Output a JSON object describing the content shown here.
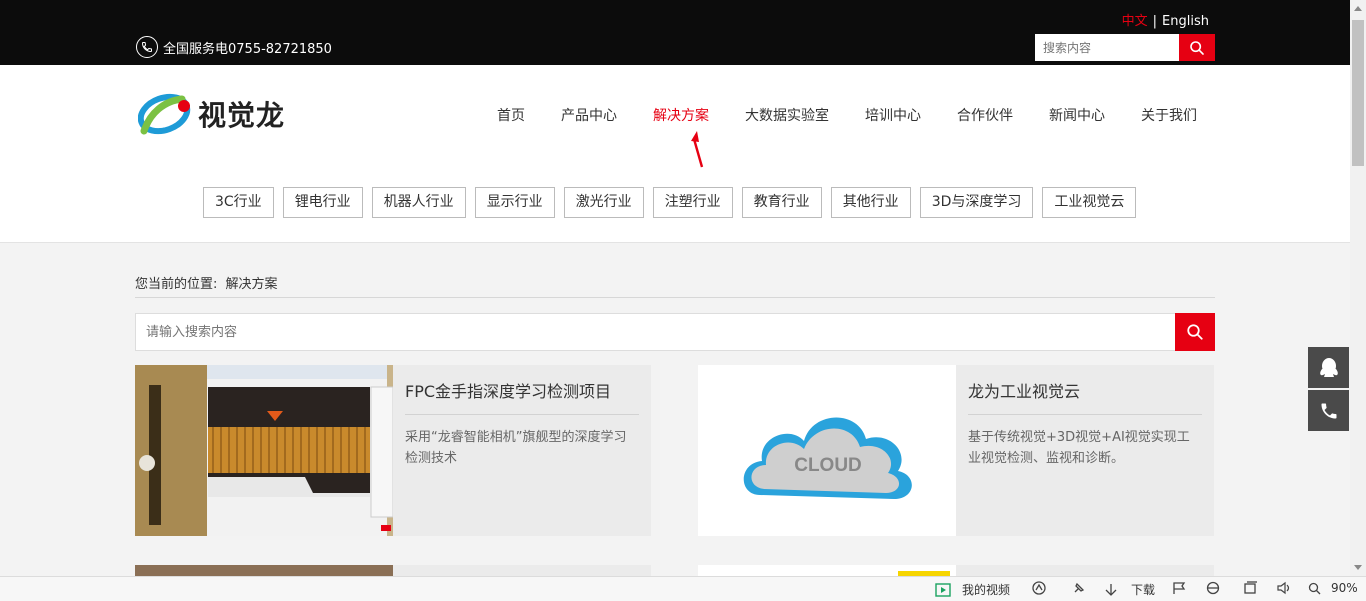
{
  "topbar": {
    "lang_zh": "中文",
    "lang_sep": "|",
    "lang_en": "English",
    "phone_text": "全国服务电0755-82721850",
    "search_placeholder": "搜索内容"
  },
  "header": {
    "logo_text": "视觉龙",
    "nav": [
      "首页",
      "产品中心",
      "解决方案",
      "大数据实验室",
      "培训中心",
      "合作伙伴",
      "新闻中心",
      "关于我们"
    ],
    "active_nav": "解决方案",
    "categories": [
      "3C行业",
      "锂电行业",
      "机器人行业",
      "显示行业",
      "激光行业",
      "注塑行业",
      "教育行业",
      "其他行业",
      "3D与深度学习",
      "工业视觉云"
    ]
  },
  "breadcrumb": {
    "label": "您当前的位置:",
    "current": "解决方案"
  },
  "main_search": {
    "placeholder": "请输入搜索内容"
  },
  "cards": [
    {
      "title": "FPC金手指深度学习检测项目",
      "desc": "采用“龙睿智能相机”旗舰型的深度学习检测技术"
    },
    {
      "title": "龙为工业视觉云",
      "desc": "基于传统视觉+3D视觉+AI视觉实现工业视觉检测、监视和诊断。",
      "image_text": "CLOUD"
    }
  ],
  "statusbar": {
    "video": "我的视频",
    "download": "下载",
    "zoom": "90%"
  },
  "colors": {
    "accent": "#e60012",
    "topbar": "#0c0c0c"
  }
}
